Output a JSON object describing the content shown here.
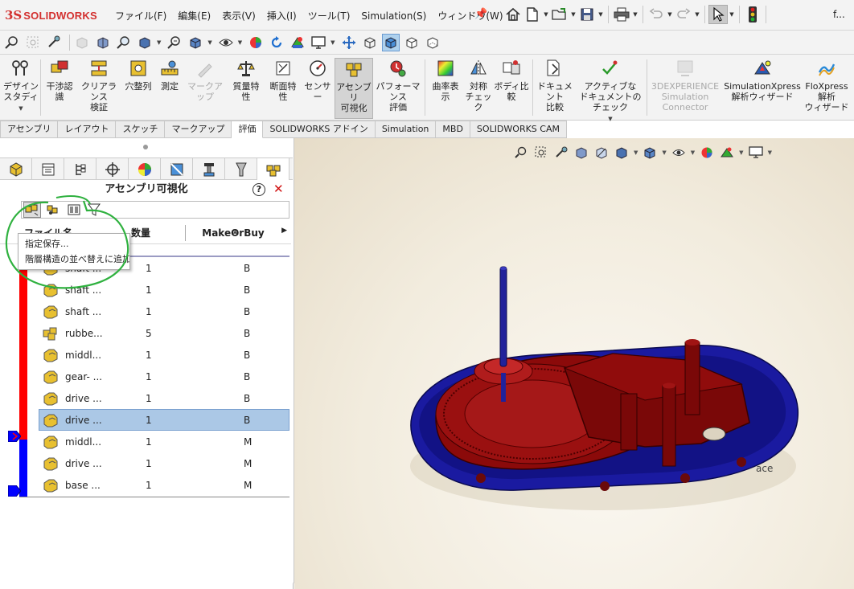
{
  "app": {
    "logo_ds": "3S",
    "logo_text": "SOLIDWORKS",
    "title_text": "f..."
  },
  "menus": [
    "ファイル(F)",
    "編集(E)",
    "表示(V)",
    "挿入(I)",
    "ツール(T)",
    "Simulation(S)",
    "ウィンドウ(W)"
  ],
  "ribbon": {
    "buttons": [
      {
        "label": "デザイン\nスタディ",
        "icon": "design-study-icon"
      },
      {
        "label": "干渉認\n識",
        "icon": "interference-icon"
      },
      {
        "label": "クリアランス\n検証",
        "icon": "clearance-icon"
      },
      {
        "label": "穴整列",
        "icon": "hole-alignment-icon"
      },
      {
        "label": "測定",
        "icon": "measure-icon"
      },
      {
        "label": "マークアップ",
        "icon": "markup-icon"
      },
      {
        "label": "質量特\n性",
        "icon": "mass-properties-icon"
      },
      {
        "label": "断面特\n性",
        "icon": "section-properties-icon"
      },
      {
        "label": "センサー",
        "icon": "sensor-icon"
      },
      {
        "label": "アセンブリ\n可視化",
        "icon": "assembly-visualization-icon"
      },
      {
        "label": "パフォーマンス\n評価",
        "icon": "performance-evaluation-icon"
      },
      {
        "label": "曲率表\n示",
        "icon": "curvature-icon"
      },
      {
        "label": "対称\nチェック",
        "icon": "symmetry-check-icon"
      },
      {
        "label": "ボディ比\n較",
        "icon": "body-compare-icon"
      },
      {
        "label": "ドキュメント\n比較",
        "icon": "compare-documents-icon"
      },
      {
        "label": "アクティブな\nドキュメントのチェック",
        "icon": "check-active-document-icon"
      },
      {
        "label": "3DEXPERIENCE\nSimulation\nConnector",
        "icon": "3dexperience-icon"
      },
      {
        "label": "SimulationXpress\n解析ウィザード",
        "icon": "simulationxpress-icon"
      },
      {
        "label": "FloXpress\n解析\nウィザード",
        "icon": "floxpress-icon"
      }
    ]
  },
  "tabs": [
    "アセンブリ",
    "レイアウト",
    "スケッチ",
    "マークアップ",
    "評価",
    "SOLIDWORKS アドイン",
    "Simulation",
    "MBD",
    "SOLIDWORKS CAM"
  ],
  "panel": {
    "title": "アセンブリ可視化",
    "help": "?",
    "close": "✕",
    "columns": {
      "name": "ファイル名",
      "qty": "数量",
      "make_or_buy": "MakeOrBuy"
    },
    "context_menu": [
      "指定保存...",
      "階層構造の並べ替えに追加"
    ],
    "rows": [
      {
        "name": "shaft ...",
        "qty": "1",
        "mob": "B",
        "icon": "part-icon"
      },
      {
        "name": "shaft ...",
        "qty": "1",
        "mob": "B",
        "icon": "part-icon"
      },
      {
        "name": "shaft ...",
        "qty": "1",
        "mob": "B",
        "icon": "part-icon"
      },
      {
        "name": "rubbe...",
        "qty": "5",
        "mob": "B",
        "icon": "subassembly-icon"
      },
      {
        "name": "middl...",
        "qty": "1",
        "mob": "B",
        "icon": "part-icon"
      },
      {
        "name": "gear- ...",
        "qty": "1",
        "mob": "B",
        "icon": "part-icon"
      },
      {
        "name": "drive ...",
        "qty": "1",
        "mob": "B",
        "icon": "part-icon"
      },
      {
        "name": "drive ...",
        "qty": "1",
        "mob": "B",
        "icon": "part-icon",
        "selected": true
      },
      {
        "name": "middl...",
        "qty": "1",
        "mob": "M",
        "icon": "part-icon"
      },
      {
        "name": "drive ...",
        "qty": "1",
        "mob": "M",
        "icon": "part-icon"
      },
      {
        "name": "base ...",
        "qty": "1",
        "mob": "M",
        "icon": "part-icon"
      }
    ]
  },
  "viewport": {
    "ghost_label": "ace"
  },
  "colors": {
    "brand_red": "#d3302f",
    "scale_red": "#ff0000",
    "scale_blue": "#0000ff",
    "model_red": "#8b0a0a",
    "model_blue": "#1a1aa0",
    "annotation_green": "#2fb13f",
    "selection_blue": "#abc8e6"
  }
}
